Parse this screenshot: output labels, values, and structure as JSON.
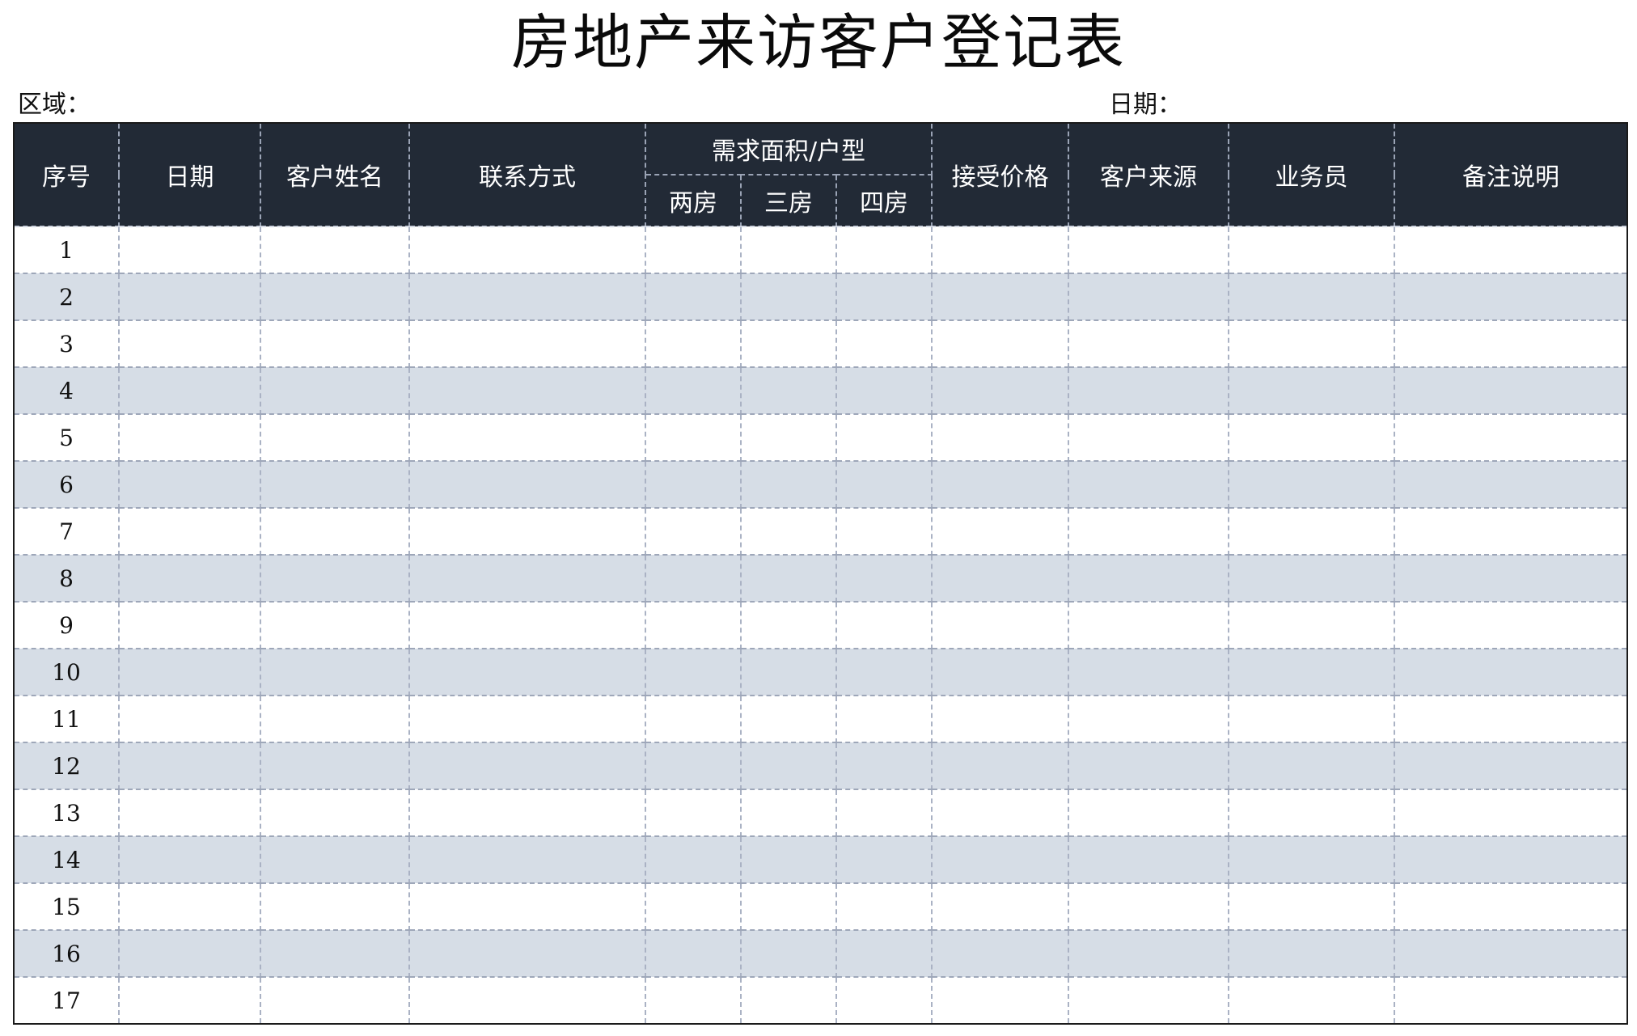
{
  "title": "房地产来访客户登记表",
  "meta": {
    "region_label": "区域：",
    "date_label": "日期："
  },
  "table": {
    "headers": {
      "seq": "序号",
      "date": "日期",
      "customer_name": "客户姓名",
      "contact": "联系方式",
      "demand_group": "需求面积/户型",
      "two_room": "两房",
      "three_room": "三房",
      "four_room": "四房",
      "accepted_price": "接受价格",
      "customer_source": "客户来源",
      "salesperson": "业务员",
      "remarks": "备注说明"
    },
    "rows": [
      "1",
      "2",
      "3",
      "4",
      "5",
      "6",
      "7",
      "8",
      "9",
      "10",
      "11",
      "12",
      "13",
      "14",
      "15",
      "16",
      "17"
    ]
  }
}
